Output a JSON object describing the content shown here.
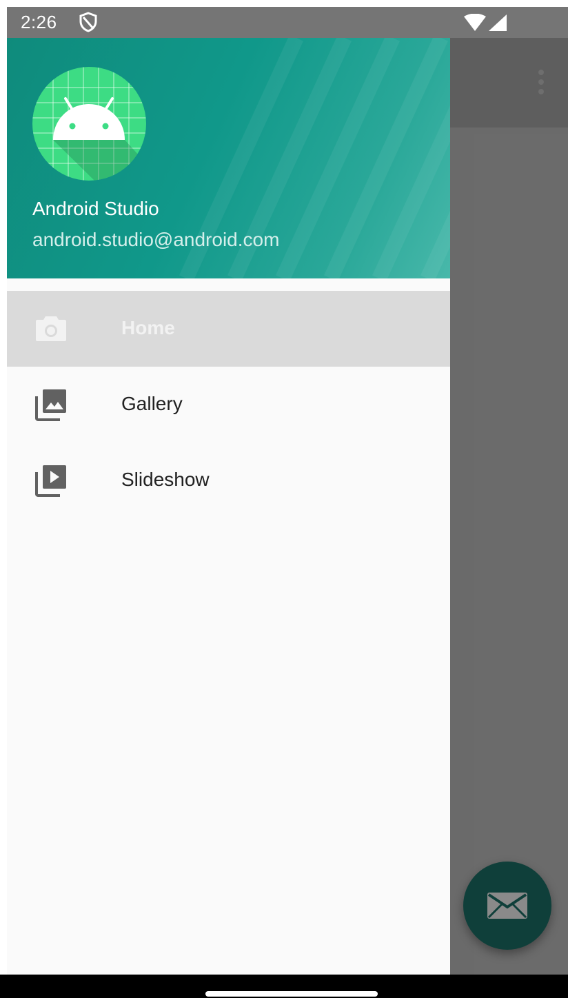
{
  "status_bar": {
    "time": "2:26",
    "icons": [
      "shield-icon",
      "wifi-icon",
      "signal-icon"
    ]
  },
  "drawer": {
    "header": {
      "name": "Android Studio",
      "email": "android.studio@android.com",
      "avatar_icon": "android-logo-icon"
    },
    "items": [
      {
        "label": "Home",
        "icon": "camera-icon",
        "selected": true
      },
      {
        "label": "Gallery",
        "icon": "gallery-icon",
        "selected": false
      },
      {
        "label": "Slideshow",
        "icon": "slideshow-icon",
        "selected": false
      }
    ]
  },
  "background_app": {
    "toolbar_icon": "overflow-menu-icon",
    "fab_icon": "mail-icon"
  },
  "colors": {
    "header_teal": "#10988a",
    "android_green": "#3ddc84",
    "fab": "#0f3f3a",
    "selected_row": "#dadada",
    "drawer_bg": "#fafafa"
  }
}
